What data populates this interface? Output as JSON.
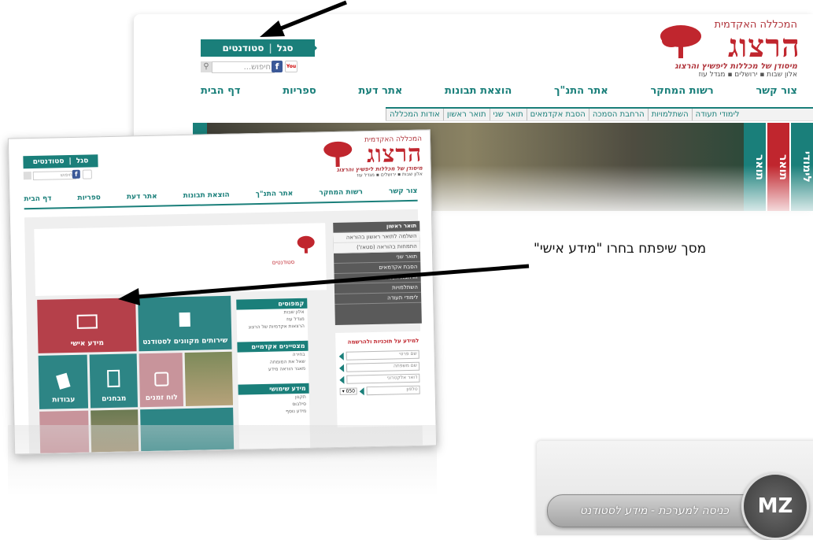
{
  "main_screenshot": {
    "logo": {
      "top_text": "המכללה האקדמית",
      "name": "הרצוג",
      "subtitle": "מיסודן של מכללות ליפשיץ והרצוג",
      "cities": "אלון שבות  ▪  ירושלים  ▪  מגדל עוז"
    },
    "login": {
      "students": "סטודנטים",
      "staff": "סגל"
    },
    "search": {
      "placeholder": "חיפוש..."
    },
    "social": {
      "facebook": "f",
      "youtube": "You"
    },
    "nav": [
      "דף הבית",
      "ספריות",
      "אתר דעת",
      "הוצאת תבונות",
      "אתר התנ\"ך",
      "רשות המחקר",
      "צור קשר"
    ],
    "subnav": [
      "אודות המכללה",
      "תואר ראשון",
      "תואר שני",
      "הסבת אקדמאים",
      "הרחבת הסמכה",
      "השתלמויות",
      "לימודי תעודה"
    ],
    "side_vertical": [
      "תואר",
      "תואר",
      "לימודי"
    ]
  },
  "second_screenshot": {
    "logo": {
      "top_text": "המכללה האקדמית",
      "name": "הרצוג",
      "subtitle": "מיסודן של מכללות ליפשיץ והרצוג",
      "cities": "אלון שבות  ▪  ירושלים  ▪  מגדל עוז"
    },
    "login": {
      "students": "סטודנטים",
      "staff": "סגל"
    },
    "search": {
      "placeholder": "חיפוש"
    },
    "nav": [
      "דף הבית",
      "ספריות",
      "אתר דעת",
      "הוצאת תבונות",
      "אתר התנ\"ך",
      "רשות המחקר",
      "צור קשר"
    ],
    "students_logo_text": "סטודנטים",
    "tiles": {
      "personal_info": "מידע אישי",
      "student_services": "שירותים מקוונים לסטודנט",
      "works": "עבודות",
      "exams": "מבחנים",
      "timetable": "לוח זמנים"
    },
    "right_menu": {
      "bachelor_header": "תואר ראשון",
      "bachelor_items": [
        "השלמה לתואר ראשון בהוראה",
        "התמחות בהוראה (סטאז')"
      ],
      "masters": "תואר שני",
      "retraining": "הסבת אקדמאים",
      "expansion": "הרחבת הסמכה",
      "courses": "השתלמויות",
      "certificate": "לימודי תעודה"
    },
    "info_form": {
      "title": "למידע על תוכניות ולהרשמה",
      "fields": [
        "שם פרטי",
        "שם משפחה",
        "דואר אלקטרוני",
        "טלפון"
      ],
      "prefix": "▾ 050"
    },
    "panels": {
      "campuses": {
        "title": "קמפוסים",
        "lines": [
          "אלון שבות",
          "מגדל עוז",
          "הרצאות אקדמיות של הרצוג"
        ]
      },
      "graduates": {
        "title": "מצטיינים אקדמיים",
        "lines": [
          "בחירה",
          "שאל את המומחה",
          "מאגר הוראה מידע"
        ]
      },
      "useful_info": {
        "title": "מידע שימושי",
        "lines": [
          "תקנון",
          "סילבוס",
          "מידע נוסף"
        ]
      }
    }
  },
  "caption": {
    "text": "מסך שיפתח בחרו \"מידע אישי\""
  },
  "bottom_button": {
    "label": "כניסה למערכת - מידע לסטודנט",
    "logo_text": "MZ"
  },
  "colors": {
    "brand_red": "#c0262e",
    "brand_teal": "#1a7f7a",
    "tile_red": "#b5404a",
    "tile_teal": "#2d8585",
    "tile_pink": "#c8949b"
  }
}
